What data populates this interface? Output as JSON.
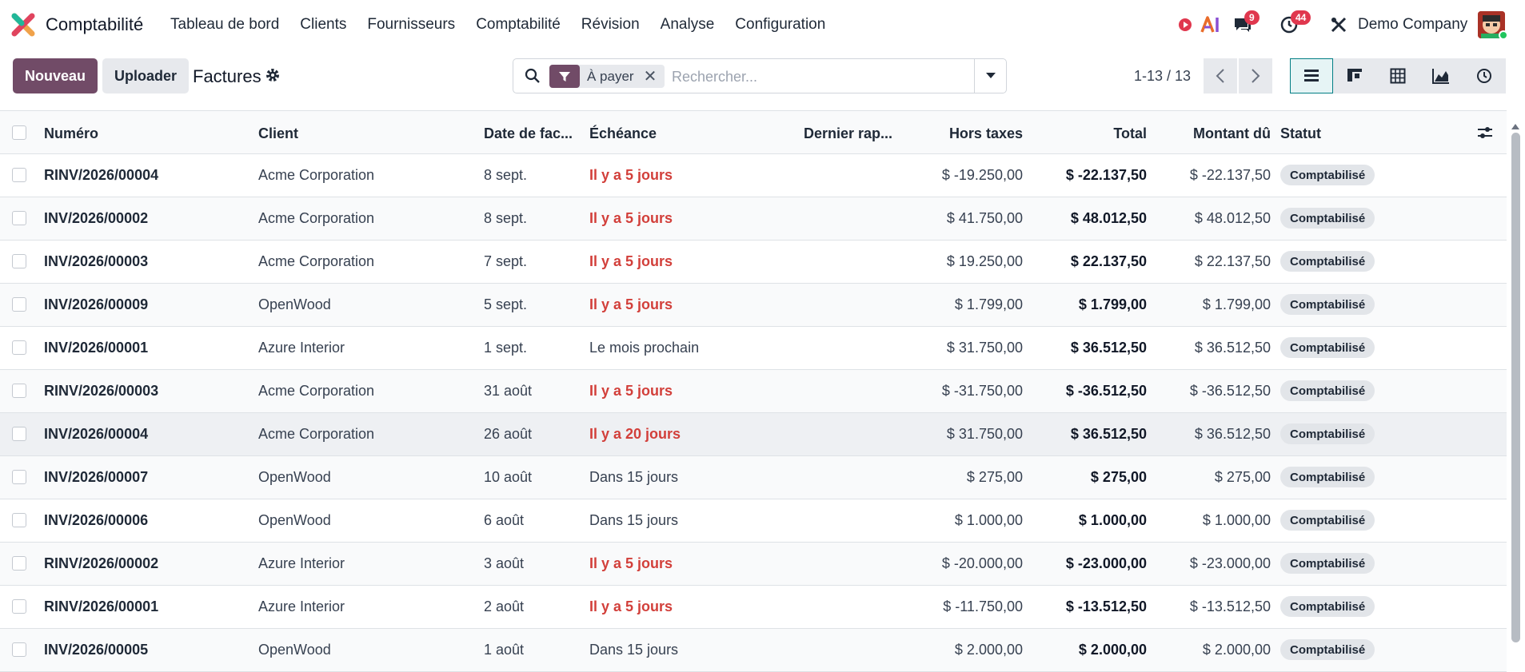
{
  "app": {
    "title": "Comptabilité"
  },
  "menu": [
    "Tableau de bord",
    "Clients",
    "Fournisseurs",
    "Comptabilité",
    "Révision",
    "Analyse",
    "Configuration"
  ],
  "systray": {
    "messages_count": "9",
    "activities_count": "44",
    "company": "Demo Company",
    "ai_label": "AI"
  },
  "actions": {
    "new_label": "Nouveau",
    "upload_label": "Uploader"
  },
  "page": {
    "title": "Factures"
  },
  "search": {
    "facet": "À payer",
    "placeholder": "Rechercher..."
  },
  "pager": {
    "value": "1-13 / 13"
  },
  "columns": {
    "number": "Numéro",
    "client": "Client",
    "invoice_date": "Date de fac...",
    "due": "Échéance",
    "last_reminder": "Dernier rap...",
    "untaxed": "Hors taxes",
    "total": "Total",
    "amount_due": "Montant dû",
    "status": "Statut"
  },
  "rows": [
    {
      "number": "RINV/2026/00004",
      "client": "Acme Corporation",
      "date": "8 sept.",
      "due": "Il y a 5 jours",
      "late": true,
      "untaxed": "$ -19.250,00",
      "total": "$ -22.137,50",
      "amount_due": "$ -22.137,50",
      "status": "Comptabilisé"
    },
    {
      "number": "INV/2026/00002",
      "client": "Acme Corporation",
      "date": "8 sept.",
      "due": "Il y a 5 jours",
      "late": true,
      "untaxed": "$ 41.750,00",
      "total": "$ 48.012,50",
      "amount_due": "$ 48.012,50",
      "status": "Comptabilisé"
    },
    {
      "number": "INV/2026/00003",
      "client": "Acme Corporation",
      "date": "7 sept.",
      "due": "Il y a 5 jours",
      "late": true,
      "untaxed": "$ 19.250,00",
      "total": "$ 22.137,50",
      "amount_due": "$ 22.137,50",
      "status": "Comptabilisé"
    },
    {
      "number": "INV/2026/00009",
      "client": "OpenWood",
      "date": "5 sept.",
      "due": "Il y a 5 jours",
      "late": true,
      "untaxed": "$ 1.799,00",
      "total": "$ 1.799,00",
      "amount_due": "$ 1.799,00",
      "status": "Comptabilisé"
    },
    {
      "number": "INV/2026/00001",
      "client": "Azure Interior",
      "date": "1 sept.",
      "due": "Le mois prochain",
      "late": false,
      "untaxed": "$ 31.750,00",
      "total": "$ 36.512,50",
      "amount_due": "$ 36.512,50",
      "status": "Comptabilisé"
    },
    {
      "number": "RINV/2026/00003",
      "client": "Acme Corporation",
      "date": "31 août",
      "due": "Il y a 5 jours",
      "late": true,
      "untaxed": "$ -31.750,00",
      "total": "$ -36.512,50",
      "amount_due": "$ -36.512,50",
      "status": "Comptabilisé"
    },
    {
      "number": "INV/2026/00004",
      "client": "Acme Corporation",
      "date": "26 août",
      "due": "Il y a 20 jours",
      "late": true,
      "untaxed": "$ 31.750,00",
      "total": "$ 36.512,50",
      "amount_due": "$ 36.512,50",
      "status": "Comptabilisé"
    },
    {
      "number": "INV/2026/00007",
      "client": "OpenWood",
      "date": "10 août",
      "due": "Dans 15 jours",
      "late": false,
      "untaxed": "$ 275,00",
      "total": "$ 275,00",
      "amount_due": "$ 275,00",
      "status": "Comptabilisé"
    },
    {
      "number": "INV/2026/00006",
      "client": "OpenWood",
      "date": "6 août",
      "due": "Dans 15 jours",
      "late": false,
      "untaxed": "$ 1.000,00",
      "total": "$ 1.000,00",
      "amount_due": "$ 1.000,00",
      "status": "Comptabilisé"
    },
    {
      "number": "RINV/2026/00002",
      "client": "Azure Interior",
      "date": "3 août",
      "due": "Il y a 5 jours",
      "late": true,
      "untaxed": "$ -20.000,00",
      "total": "$ -23.000,00",
      "amount_due": "$ -23.000,00",
      "status": "Comptabilisé"
    },
    {
      "number": "RINV/2026/00001",
      "client": "Azure Interior",
      "date": "2 août",
      "due": "Il y a 5 jours",
      "late": true,
      "untaxed": "$ -11.750,00",
      "total": "$ -13.512,50",
      "amount_due": "$ -13.512,50",
      "status": "Comptabilisé"
    },
    {
      "number": "INV/2026/00005",
      "client": "OpenWood",
      "date": "1 août",
      "due": "Dans 15 jours",
      "late": false,
      "untaxed": "$ 2.000,00",
      "total": "$ 2.000,00",
      "amount_due": "$ 2.000,00",
      "status": "Comptabilisé"
    }
  ],
  "colors": {
    "brand": "#714b67",
    "late": "#d23f3a",
    "active_view": "#017e84"
  },
  "icons": {
    "search": "search-icon",
    "filter": "filter-icon",
    "gear": "gear-icon",
    "views": [
      "list-view-icon",
      "kanban-view-icon",
      "pivot-view-icon",
      "graph-view-icon",
      "activity-view-icon"
    ]
  }
}
